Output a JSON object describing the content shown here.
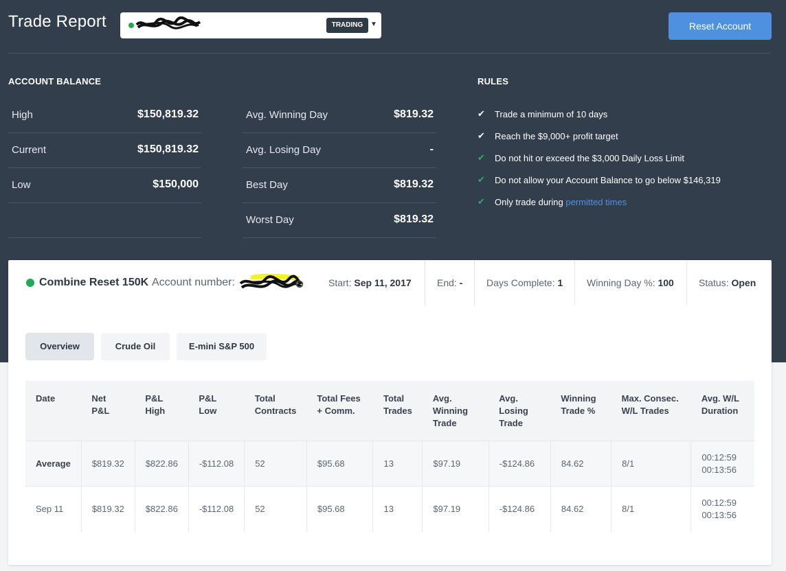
{
  "header": {
    "title": "Trade Report",
    "account_status": "TRADING",
    "reset_button": "Reset Account"
  },
  "colors": {
    "header_bg": "#323e4c",
    "accent": "#4e92df",
    "status_green": "#1faa55"
  },
  "balance": {
    "heading": "ACCOUNT BALANCE",
    "left": [
      {
        "label": "High",
        "value": "$150,819.32"
      },
      {
        "label": "Current",
        "value": "$150,819.32"
      },
      {
        "label": "Low",
        "value": "$150,000"
      }
    ],
    "right": [
      {
        "label": "Avg. Winning Day",
        "value": "$819.32"
      },
      {
        "label": "Avg. Losing Day",
        "value": "-"
      },
      {
        "label": "Best Day",
        "value": "$819.32"
      },
      {
        "label": "Worst Day",
        "value": "$819.32"
      }
    ]
  },
  "rules": {
    "heading": "RULES",
    "items": [
      {
        "text": "Trade a minimum of 10 days",
        "met": false
      },
      {
        "text": "Reach the $9,000+ profit target",
        "met": false
      },
      {
        "text": "Do not hit or exceed the $3,000 Daily Loss Limit",
        "met": true
      },
      {
        "text": "Do not allow your Account Balance to go below $146,319",
        "met": true
      },
      {
        "text": "Only trade during ",
        "link": "permitted times",
        "met": true
      }
    ]
  },
  "account": {
    "name": "Combine Reset 150K",
    "number_label": "Account number:",
    "start_label": "Start:",
    "start_value": "Sep 11, 2017",
    "end_label": "End:",
    "end_value": "-",
    "days_label": "Days Complete:",
    "days_value": "1",
    "win_pct_label": "Winning Day %:",
    "win_pct_value": "100",
    "status_label": "Status:",
    "status_value": "Open"
  },
  "tabs": [
    "Overview",
    "Crude Oil",
    "E-mini S&P 500"
  ],
  "table": {
    "headers": [
      [
        "Date"
      ],
      [
        "Net",
        "P&L"
      ],
      [
        "P&L",
        "High"
      ],
      [
        "P&L",
        "Low"
      ],
      [
        "Total",
        "Contracts"
      ],
      [
        "Total Fees",
        "+ Comm."
      ],
      [
        "Total",
        "Trades"
      ],
      [
        "Avg.",
        "Winning",
        "Trade"
      ],
      [
        "Avg.",
        "Losing",
        "Trade"
      ],
      [
        "Winning",
        "Trade %"
      ],
      [
        "Max. Consec.",
        "W/L Trades"
      ],
      [
        "Avg. W/L",
        "Duration"
      ]
    ],
    "rows": [
      {
        "cells": [
          "Average",
          "$819.32",
          "$822.86",
          "-$112.08",
          "52",
          "$95.68",
          "13",
          "$97.19",
          "-$124.86",
          "84.62",
          "8/1"
        ],
        "duration": [
          "00:12:59",
          "00:13:56"
        ]
      },
      {
        "cells": [
          "Sep 11",
          "$819.32",
          "$822.86",
          "-$112.08",
          "52",
          "$95.68",
          "13",
          "$97.19",
          "-$124.86",
          "84.62",
          "8/1"
        ],
        "duration": [
          "00:12:59",
          "00:13:56"
        ]
      }
    ]
  }
}
